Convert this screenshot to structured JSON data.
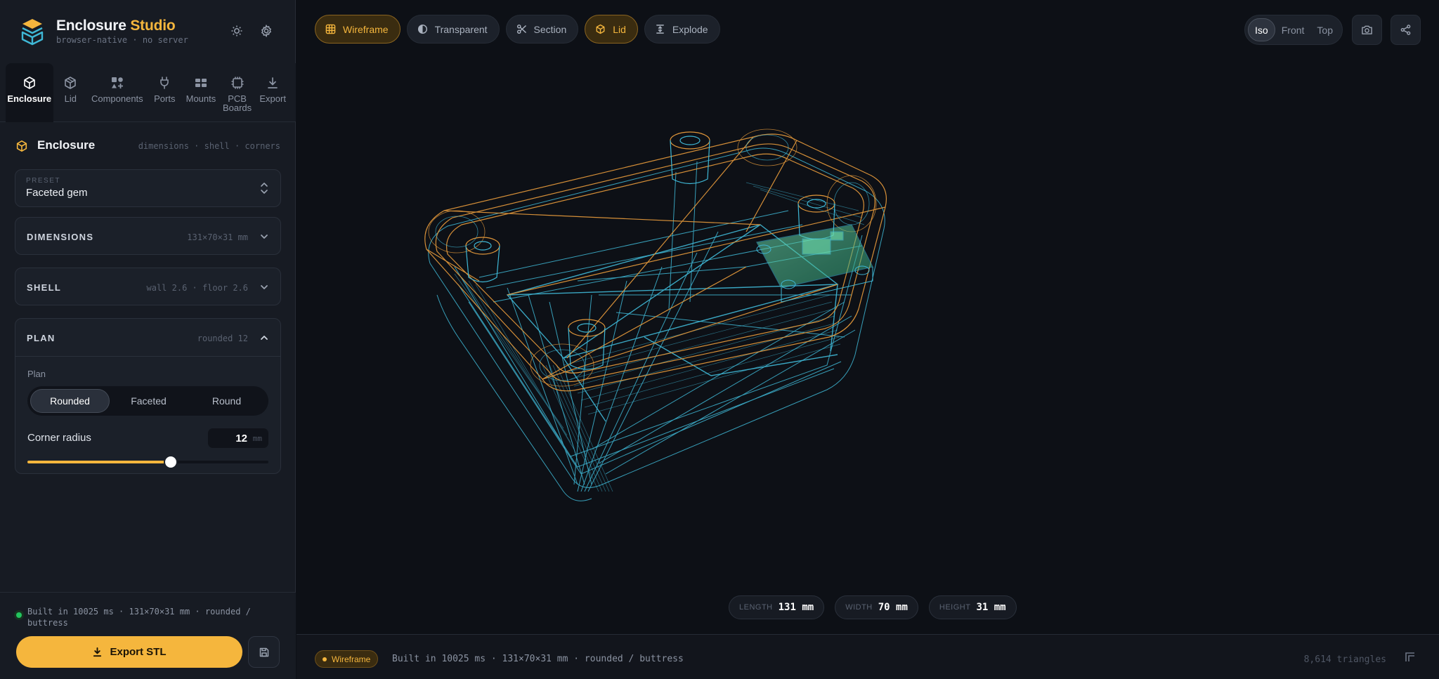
{
  "app": {
    "title_main": "Enclosure",
    "title_accent": "Studio",
    "subtitle": "browser-native · no server"
  },
  "nav": [
    {
      "label": "Enclosure",
      "icon": "cube-icon",
      "active": true
    },
    {
      "label": "Lid",
      "icon": "lid-box-icon",
      "active": false
    },
    {
      "label": "Components",
      "icon": "components-icon",
      "active": false
    },
    {
      "label": "Ports",
      "icon": "plug-icon",
      "active": false
    },
    {
      "label": "Mounts",
      "icon": "mounts-icon",
      "active": false
    },
    {
      "label": "PCB Boards",
      "icon": "pcb-icon",
      "active": false
    },
    {
      "label": "Export",
      "icon": "download-icon",
      "active": false
    }
  ],
  "panel": {
    "title": "Enclosure",
    "hint": "dimensions · shell · corners",
    "preset_label": "PRESET",
    "preset_value": "Faceted gem",
    "sections": {
      "dimensions": {
        "name": "DIMENSIONS",
        "meta": "131×70×31 mm"
      },
      "shell": {
        "name": "SHELL",
        "meta": "wall 2.6 · floor 2.6"
      },
      "plan": {
        "name": "PLAN",
        "meta": "rounded 12"
      }
    },
    "plan_field_label": "Plan",
    "plan_options": [
      "Rounded",
      "Faceted",
      "Round"
    ],
    "plan_selected": "Rounded",
    "corner_radius_label": "Corner radius",
    "corner_radius_value": "12",
    "corner_radius_unit": "mm",
    "corner_radius_fraction": 0.595
  },
  "footer": {
    "build_status": "Built in 10025 ms · 131×70×31 mm · rounded / buttress",
    "export_label": "Export STL"
  },
  "toolbar": [
    {
      "label": "Wireframe",
      "icon": "grid-icon",
      "active": true
    },
    {
      "label": "Transparent",
      "icon": "half-circle-icon",
      "active": false
    },
    {
      "label": "Section",
      "icon": "scissors-icon",
      "active": false
    },
    {
      "label": "Lid",
      "icon": "lid-box-icon",
      "active": true
    },
    {
      "label": "Explode",
      "icon": "explode-icon",
      "active": false
    }
  ],
  "views": [
    "Iso",
    "Front",
    "Top"
  ],
  "view_selected": "Iso",
  "dims": [
    {
      "label": "LENGTH",
      "value": "131 mm"
    },
    {
      "label": "WIDTH",
      "value": "70 mm"
    },
    {
      "label": "HEIGHT",
      "value": "31 mm"
    }
  ],
  "statusbar": {
    "mode": "Wireframe",
    "text": "Built in 10025 ms · 131×70×31 mm · rounded / buttress",
    "triangles": "8,614 triangles"
  },
  "colors": {
    "accent": "#f5b63d",
    "wire_body": "#3fb8d6",
    "wire_lid": "#e0963a",
    "pcb": "#4fd09a",
    "ok": "#22c55e"
  }
}
